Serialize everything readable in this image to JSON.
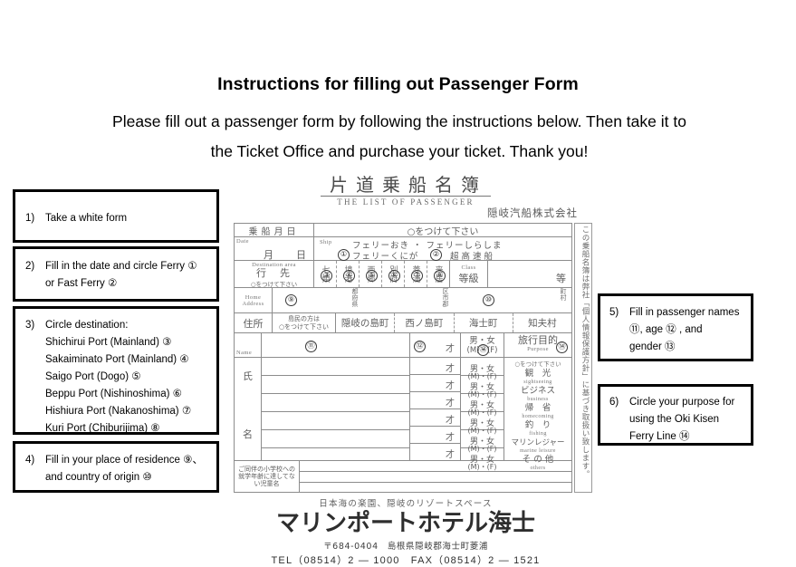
{
  "header": {
    "title": "Instructions for filling out Passenger Form",
    "intro_line1": "Please fill out a passenger form by following the instructions below. Then take it to",
    "intro_line2": "the Ticket Office and purchase your ticket. Thank you!"
  },
  "instructions": [
    {
      "number": "1)",
      "lines": [
        "Take a white form"
      ]
    },
    {
      "number": "2)",
      "lines": [
        "Fill in the date and circle Ferry ①",
        "or Fast Ferry ②"
      ]
    },
    {
      "number": "3)",
      "lines": [
        "Circle destination:",
        "Shichirui Port (Mainland) ③",
        "Sakaiminato Port (Mainland) ④",
        "Saigo Port (Dogo) ⑤",
        "Beppu Port (Nishinoshima) ⑥",
        "Hishiura Port (Nakanoshima) ⑦",
        "Kuri Port (Chiburijima) ⑧"
      ]
    },
    {
      "number": "4)",
      "lines": [
        "Fill in your place of residence ⑨、",
        "and country of origin ⑩"
      ]
    },
    {
      "number": "5)",
      "lines": [
        "Fill in passenger names",
        "⑪, age  ⑫ , and",
        "gender  ⑬"
      ]
    },
    {
      "number": "6)",
      "lines": [
        "Circle your purpose for",
        "using the Oki Kisen",
        "Ferry Line ⑭"
      ]
    }
  ],
  "form": {
    "jp_title": "片道乗船名簿",
    "en_title": "THE LIST OF PASSENGER",
    "company": "隠岐汽船株式会社",
    "date_label_jp": "乗船月日",
    "date_label_en": "Date",
    "date_month": "月",
    "date_day": "日",
    "circle_instruction": "○をつけて下さい",
    "ship_label_en": "Ship",
    "ship_option1": "フェリーおき ・ フェリーしらしま",
    "ship_option2_a": "フェリーくにが",
    "ship_option2_b": "超高速船",
    "ship_marker1": "①",
    "ship_marker2": "②",
    "destination_label_en": "Destination area",
    "destination_label_jp": "行　先",
    "destination_note": "○をつけて下さい",
    "ports": [
      {
        "name": "七類",
        "marker": "③"
      },
      {
        "name": "境港",
        "marker": "④"
      },
      {
        "name": "西郷",
        "marker": "⑤"
      },
      {
        "name": "別府",
        "marker": "⑥"
      },
      {
        "name": "菱浦",
        "marker": "⑦"
      },
      {
        "name": "来居",
        "marker": "⑧"
      }
    ],
    "class_label_en": "Class",
    "class_label_jp": "等級",
    "class_unit": "等",
    "address_label_en": "Home Address",
    "address_label_jp": "住所",
    "address_marker": "⑨",
    "address_pref": "都府県",
    "address_city": "区市郡",
    "address_town": "町村",
    "country_marker": "⑩",
    "islander_note_line1": "島民の方は",
    "islander_note_line2": "○をつけて下さい",
    "towns": [
      "隠岐の島町",
      "西ノ島町",
      "海士町",
      "知夫村"
    ],
    "name_label_en": "Name",
    "name_label_jp1": "氏",
    "name_label_jp2": "名",
    "name_marker": "⑪",
    "age_marker": "⑫",
    "age_unit": "才",
    "gender_jp": "男・女",
    "gender_en": "(M)・(F)",
    "gender_marker": "⑬",
    "purpose_label_jp": "旅行目的",
    "purpose_label_en": "Purpose",
    "purpose_marker": "⑭",
    "purpose_note": "○をつけて下さい",
    "purposes": [
      {
        "jp": "観　光",
        "en": "sightseeing"
      },
      {
        "jp": "ビジネス",
        "en": "business"
      },
      {
        "jp": "帰　省",
        "en": "homecoming"
      },
      {
        "jp": "釣　り",
        "en": "fishing"
      },
      {
        "jp": "マリンレジャー",
        "en": "marine leisure"
      },
      {
        "jp": "そ の 他",
        "en": "others"
      }
    ],
    "child_note": "ご同伴の小学校への就学年齢に達してない児童名",
    "privacy_note": "この乗船名簿は弊社「個人情報保護方針」に基づき取扱い致します。"
  },
  "hotel": {
    "tagline": "日本海の楽園、隠岐のリゾートスペース",
    "name": "マリンポートホテル海士",
    "address": "〒684-0404　島根県隠岐郡海士町菱浦",
    "contact": "TEL（08514）2 — 1000　FAX（08514）2 — 1521"
  }
}
